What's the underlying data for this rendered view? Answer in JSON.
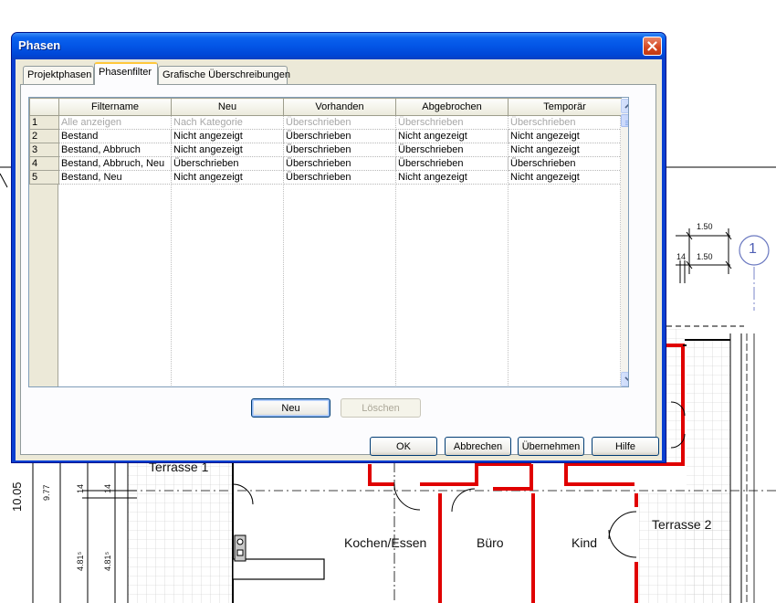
{
  "dialog": {
    "title": "Phasen",
    "tabs": [
      {
        "label": "Projektphasen"
      },
      {
        "label": "Phasenfilter",
        "active": true
      },
      {
        "label": "Grafische Überschreibungen"
      }
    ],
    "table": {
      "columns": [
        "Filtername",
        "Neu",
        "Vorhanden",
        "Abgebrochen",
        "Temporär"
      ],
      "rows": [
        {
          "num": "1",
          "cells": [
            "Alle anzeigen",
            "Nach Kategorie",
            "Überschrieben",
            "Überschrieben",
            "Überschrieben"
          ],
          "disabled": true
        },
        {
          "num": "2",
          "cells": [
            "Bestand",
            "Nicht angezeigt",
            "Überschrieben",
            "Nicht angezeigt",
            "Nicht angezeigt"
          ]
        },
        {
          "num": "3",
          "cells": [
            "Bestand, Abbruch",
            "Nicht angezeigt",
            "Überschrieben",
            "Überschrieben",
            "Nicht angezeigt"
          ]
        },
        {
          "num": "4",
          "cells": [
            "Bestand, Abbruch, Neu",
            "Überschrieben",
            "Überschrieben",
            "Überschrieben",
            "Überschrieben"
          ]
        },
        {
          "num": "5",
          "cells": [
            "Bestand, Neu",
            "Nicht angezeigt",
            "Überschrieben",
            "Nicht angezeigt",
            "Nicht angezeigt"
          ]
        }
      ]
    },
    "panel_buttons": {
      "new": "Neu",
      "delete": "Löschen"
    },
    "footer_buttons": {
      "ok": "OK",
      "cancel": "Abbrechen",
      "apply": "Übernehmen",
      "help": "Hilfe"
    },
    "close_icon": "close-icon",
    "colors": {
      "titlebar": "#0355e6",
      "close": "#d4461f",
      "tab_highlight": "#ffc83c"
    }
  },
  "drawing": {
    "rooms": [
      "Terrasse 1",
      "Kochen/Essen",
      "Büro",
      "Kind",
      "Terrasse 2"
    ],
    "dimensions": [
      "1.50",
      "1.50",
      "14",
      "10.05",
      "9.77",
      "14",
      "14",
      "4.81⁵",
      "4.81⁵"
    ],
    "grid_marker": "1",
    "colors": {
      "walls": "#e00000",
      "lines": "#000000"
    }
  }
}
